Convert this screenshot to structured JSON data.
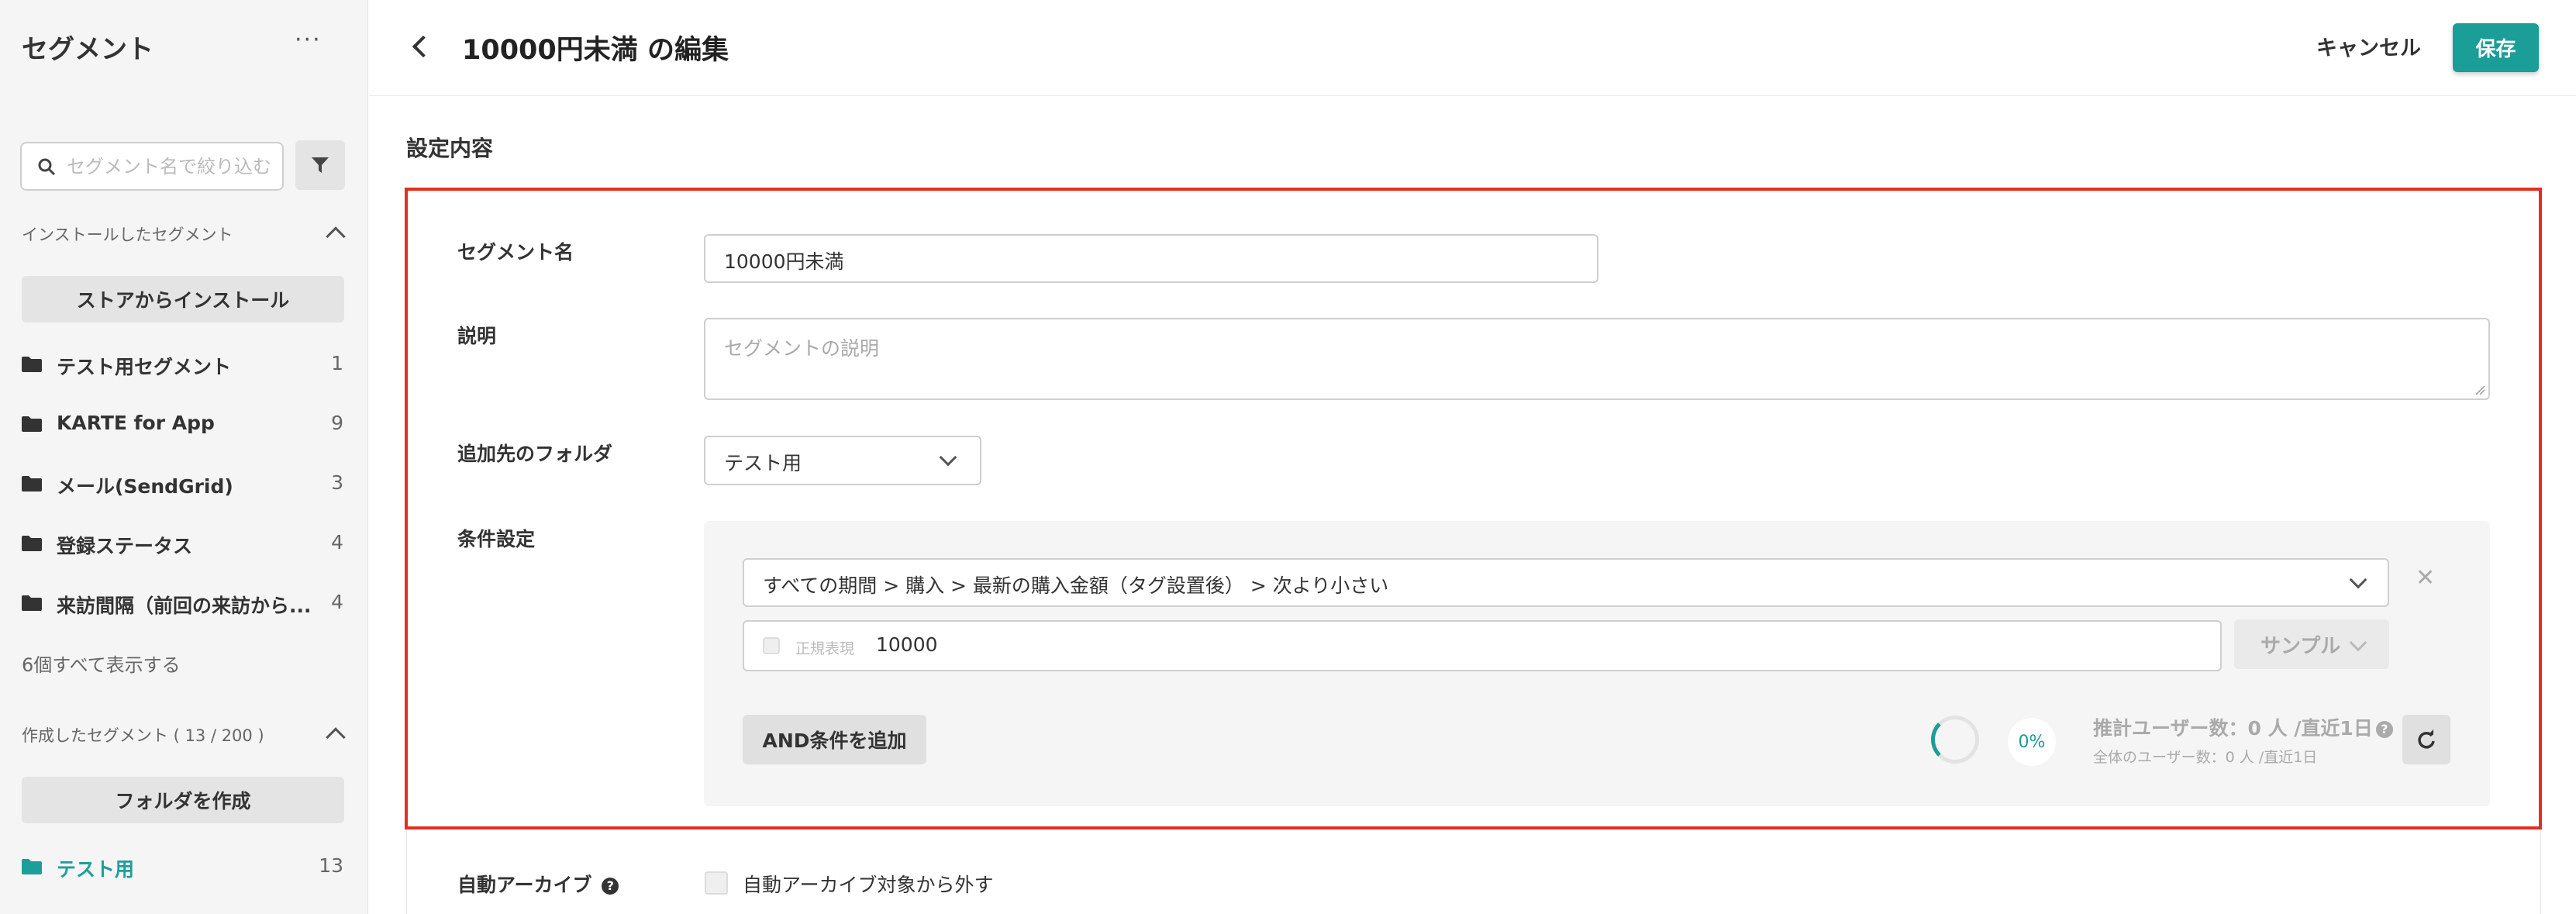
{
  "sidebar": {
    "title": "セグメント",
    "more": "···",
    "search_placeholder": "セグメント名で絞り込む",
    "installed_header": "インストールしたセグメント",
    "install_button": "ストアからインストール",
    "installed_folders": [
      {
        "label": "テスト用セグメント",
        "count": "1"
      },
      {
        "label": "KARTE for App",
        "count": "9"
      },
      {
        "label": "メール(SendGrid)",
        "count": "3"
      },
      {
        "label": "登録ステータス",
        "count": "4"
      },
      {
        "label": "来訪間隔（前回の来訪から...",
        "count": "4"
      }
    ],
    "show_all": "6個すべて表示する",
    "created_header": "作成したセグメント ( 13 / 200 )",
    "create_folder_button": "フォルダを作成",
    "created_folders": [
      {
        "label": "テスト用",
        "count": "13"
      }
    ]
  },
  "header": {
    "title": "10000円未満 の編集",
    "cancel": "キャンセル",
    "save": "保存"
  },
  "section_title": "設定内容",
  "form": {
    "name_label": "セグメント名",
    "name_value": "10000円未満",
    "desc_label": "説明",
    "desc_placeholder": "セグメントの説明",
    "folder_label": "追加先のフォルダ",
    "folder_value": "テスト用",
    "condition_label": "条件設定",
    "condition_path": "すべての期間 > 購入 > 最新の購入金額（タグ設置後） > 次より小さい",
    "regex_label": "正規表現",
    "condition_value": "10000",
    "sample": "サンプル",
    "and_button": "AND条件を追加",
    "progress": "0%",
    "estimate": "推計ユーザー数：0 人 /直近1日",
    "total": "全体のユーザー数：0 人 /直近1日",
    "auto_archive_label": "自動アーカイブ",
    "auto_archive_checkbox": "自動アーカイブ対象から外す"
  },
  "colors": {
    "accent": "#1b9d98",
    "highlight": "#e0301e"
  }
}
